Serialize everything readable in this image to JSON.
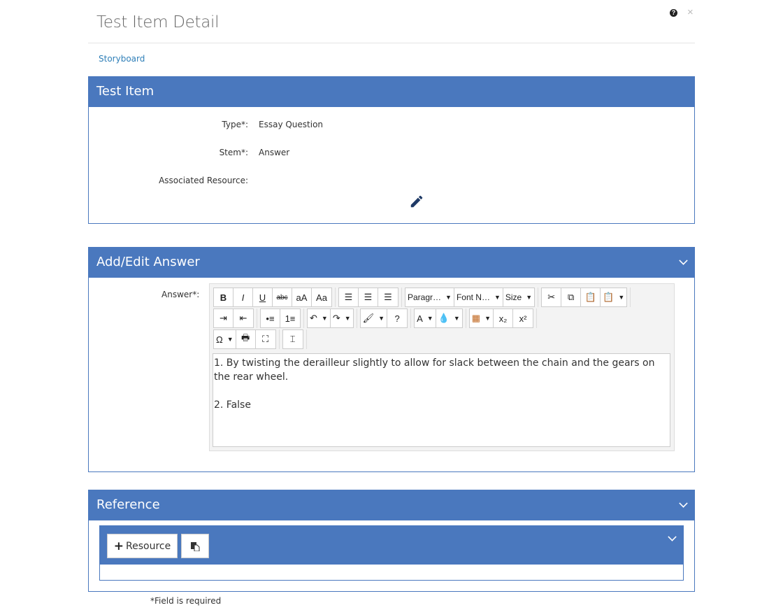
{
  "dialog": {
    "title": "Test Item Detail",
    "help": "?",
    "close": "×"
  },
  "breadcrumb": "Storyboard",
  "test_item": {
    "header": "Test Item",
    "type_label": "Type*:",
    "type_value": "Essay Question",
    "stem_label": "Stem*:",
    "stem_value": "Answer",
    "resource_label": "Associated Resource:",
    "edit_icon": "pencil-icon"
  },
  "answer": {
    "header": "Add/Edit Answer",
    "label": "Answer*:",
    "lines": [
      "1. By twisting the derailleur slightly to allow for slack between the chain and the gears on the rear wheel.",
      "",
      "2. False"
    ],
    "toolbar": [
      [
        [
          {
            "n": "bold",
            "t": "B"
          },
          {
            "n": "italic",
            "t": "I"
          },
          {
            "n": "underline",
            "t": "U"
          },
          {
            "n": "strikethrough",
            "t": "abc"
          },
          {
            "n": "lowercase",
            "t": "aA"
          },
          {
            "n": "titlecase",
            "t": "Aa"
          }
        ],
        [
          {
            "n": "align-left",
            "t": "☰"
          },
          {
            "n": "align-center",
            "t": "☰"
          },
          {
            "n": "align-right",
            "t": "☰"
          }
        ],
        [
          {
            "n": "paragraph-format",
            "t": "Paragr…",
            "dd": true
          },
          {
            "n": "font-name",
            "t": "Font N…",
            "dd": true
          },
          {
            "n": "font-size",
            "t": "Size",
            "dd": true
          }
        ],
        [
          {
            "n": "cut",
            "t": "✂"
          },
          {
            "n": "copy",
            "t": "⧉"
          },
          {
            "n": "paste",
            "t": "📋"
          },
          {
            "n": "paste-special",
            "t": "📋",
            "dd": true
          }
        ]
      ],
      [
        [
          {
            "n": "indent",
            "t": "⇥"
          },
          {
            "n": "outdent",
            "t": "⇤"
          }
        ],
        [
          {
            "n": "bullet-list",
            "t": "•≡"
          },
          {
            "n": "numbered-list",
            "t": "1≡"
          }
        ],
        [
          {
            "n": "undo",
            "t": "↶",
            "dd": true
          },
          {
            "n": "redo",
            "t": "↷",
            "dd": true
          }
        ],
        [
          {
            "n": "clear-format",
            "t": "🖌",
            "dd": true
          },
          {
            "n": "help",
            "t": "?"
          }
        ],
        [
          {
            "n": "font-color",
            "t": "A",
            "dd": true
          },
          {
            "n": "background-color",
            "t": "💧",
            "dd": true
          }
        ],
        [
          {
            "n": "table",
            "t": "▦",
            "dd": true
          },
          {
            "n": "subscript",
            "t": "x₂"
          },
          {
            "n": "superscript",
            "t": "x²"
          }
        ]
      ],
      [
        [
          {
            "n": "special-character",
            "t": "Ω",
            "dd": true
          },
          {
            "n": "print",
            "t": "🖶"
          },
          {
            "n": "fullscreen",
            "t": "⛶"
          }
        ],
        [
          {
            "n": "page-break",
            "t": "⌶"
          }
        ]
      ]
    ]
  },
  "reference": {
    "header": "Reference",
    "add_resource": "Resource",
    "add_icon": "plus-icon",
    "paste_icon": "paste-icon"
  },
  "footer": {
    "required_note": "*Field is required"
  },
  "colors": {
    "accent": "#4a78be",
    "link": "#2f7fb8"
  }
}
